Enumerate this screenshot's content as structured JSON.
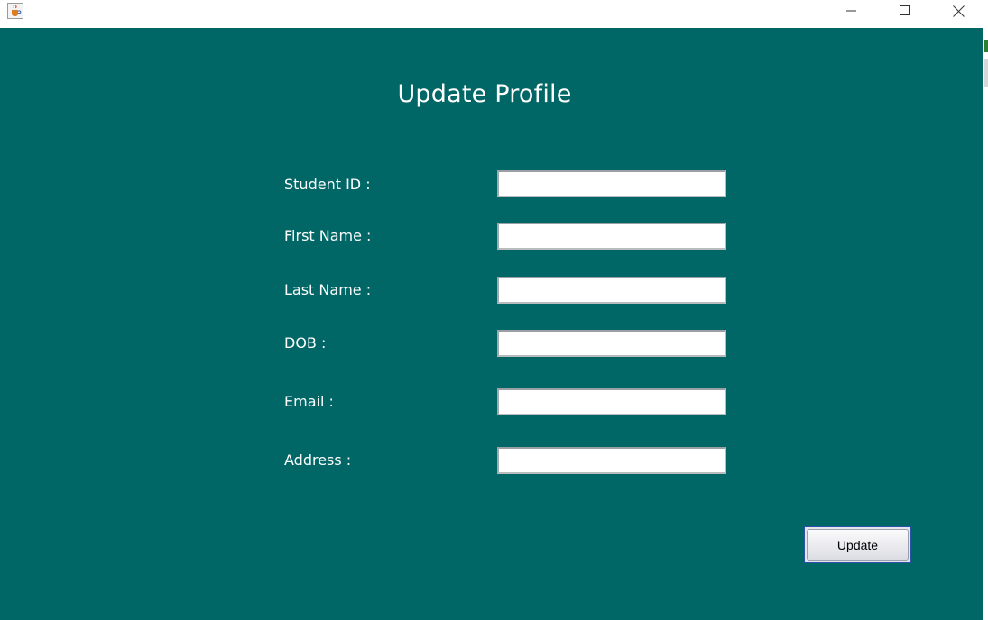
{
  "window": {
    "app_icon": "java-coffee-cup-icon",
    "controls": {
      "minimize": "minimize-icon",
      "maximize": "maximize-icon",
      "close": "close-icon"
    }
  },
  "form": {
    "title": "Update Profile",
    "fields": [
      {
        "label": "Student ID :",
        "value": ""
      },
      {
        "label": "First Name :",
        "value": ""
      },
      {
        "label": "Last Name :",
        "value": ""
      },
      {
        "label": "DOB :",
        "value": ""
      },
      {
        "label": "Email :",
        "value": ""
      },
      {
        "label": "Address :",
        "value": ""
      }
    ],
    "update_button_label": "Update"
  },
  "colors": {
    "background": "#006666",
    "text": "#ffffff",
    "button_focus_border": "#2a52a8"
  }
}
